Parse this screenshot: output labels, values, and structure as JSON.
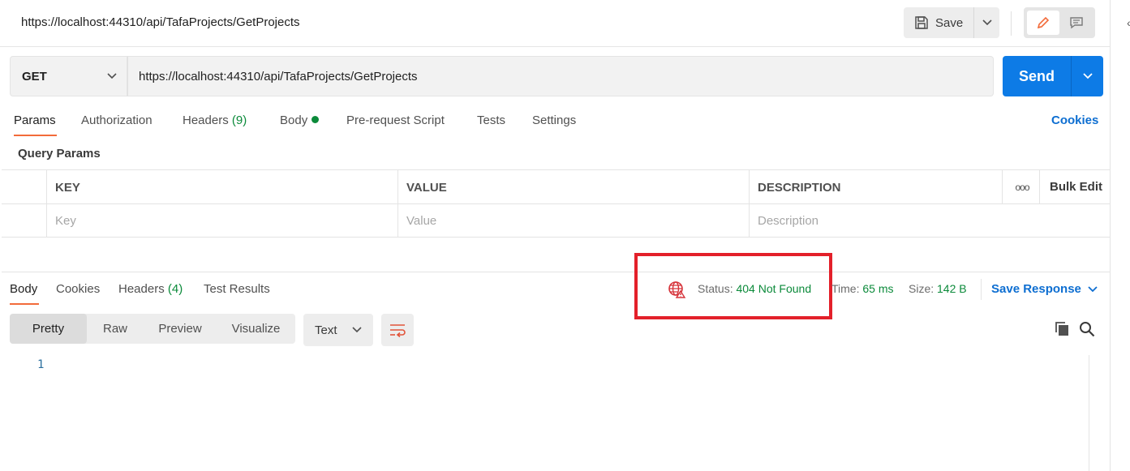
{
  "header": {
    "title": "https://localhost:44310/api/TafaProjects/GetProjects",
    "save_label": "Save"
  },
  "request": {
    "method": "GET",
    "url": "https://localhost:44310/api/TafaProjects/GetProjects",
    "send_label": "Send"
  },
  "request_tabs": {
    "params": "Params",
    "authorization": "Authorization",
    "headers": "Headers",
    "headers_count": "(9)",
    "body": "Body",
    "pre_request": "Pre-request Script",
    "tests": "Tests",
    "settings": "Settings",
    "cookies": "Cookies"
  },
  "params": {
    "section_title": "Query Params",
    "columns": {
      "key": "KEY",
      "value": "VALUE",
      "description": "DESCRIPTION"
    },
    "more_icon": "ooo",
    "bulk_edit": "Bulk Edit",
    "placeholders": {
      "key": "Key",
      "value": "Value",
      "description": "Description"
    }
  },
  "response_tabs": {
    "body": "Body",
    "cookies": "Cookies",
    "headers": "Headers",
    "headers_count": "(4)",
    "test_results": "Test Results"
  },
  "response_meta": {
    "status_label": "Status:",
    "status_value": "404 Not Found",
    "time_label": "Time:",
    "time_value": "65 ms",
    "size_label": "Size:",
    "size_value": "142 B",
    "save_response": "Save Response"
  },
  "viewer": {
    "modes": [
      "Pretty",
      "Raw",
      "Preview",
      "Visualize"
    ],
    "active_mode": "Pretty",
    "format": "Text",
    "line_numbers": [
      "1"
    ]
  },
  "colors": {
    "accent_blue": "#0d7be6",
    "tab_underline": "#f26b3a",
    "status_green": "#0b8a3a",
    "highlight_red": "#e3202a",
    "link_blue": "#0d6ed1"
  },
  "icons": [
    "save-icon",
    "chevron-down-icon",
    "pencil-icon",
    "comment-icon",
    "globe-alert-icon",
    "wrap-lines-icon",
    "copy-icon",
    "search-icon"
  ]
}
